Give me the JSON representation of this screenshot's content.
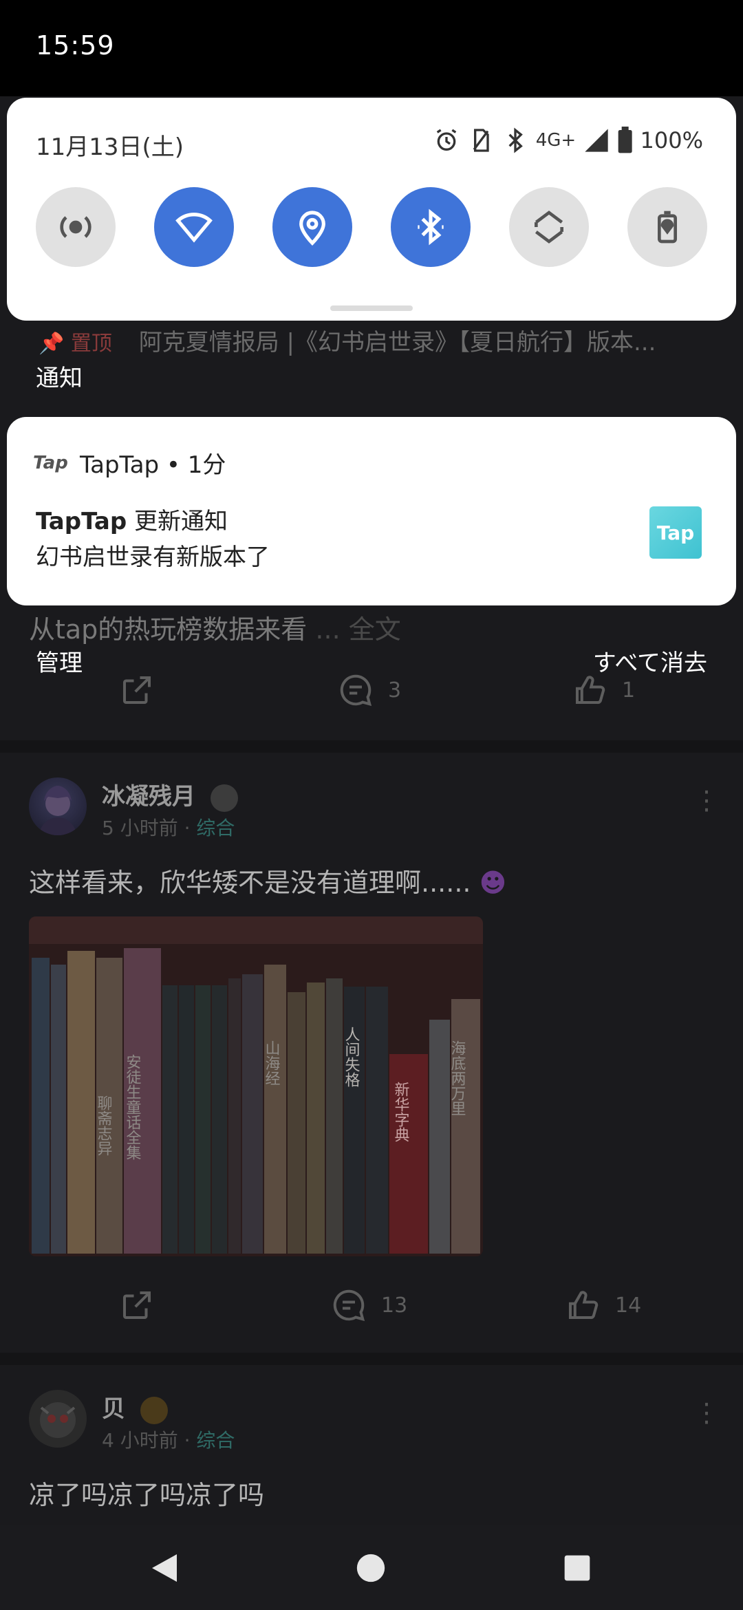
{
  "status_bar": {
    "time": "15:59"
  },
  "quick_settings": {
    "date": "11月13日(土)",
    "network": "4G+",
    "battery": "100%"
  },
  "notifications": {
    "section_label": "通知",
    "items": [
      {
        "app_name": "TapTap",
        "time_ago": "1分",
        "app_logo_text": "Tap",
        "title_brand": "TapTap",
        "title_rest": " 更新通知",
        "body": "幻书启世录有新版本了",
        "thumb_text": "Tap"
      }
    ],
    "manage_label": "管理",
    "clear_all_label": "すべて消去"
  },
  "feed": {
    "pinned_tag": "置顶",
    "pinned_title": "阿克夏情报局 |《幻书启世录》【夏日航行】版本...",
    "snippet": "从tap的热玩榜数据来看",
    "snippet_more": "... 全文",
    "post1_counts": {
      "comments": "3",
      "likes": "1"
    },
    "post2": {
      "user": "冰凝残月",
      "time": "5 小时前",
      "category": "综合",
      "text": "这样看来，欣华矮不是没有道理啊......",
      "comments": "13",
      "likes": "14"
    },
    "post3": {
      "user": "贝",
      "time": "4 小时前",
      "category": "综合",
      "text": "凉了吗凉了吗凉了吗"
    }
  },
  "book_titles": [
    "安徒生童话全集",
    "聊斋志异",
    "山海经",
    "人间失格",
    "新华字典",
    "海底两万里"
  ]
}
